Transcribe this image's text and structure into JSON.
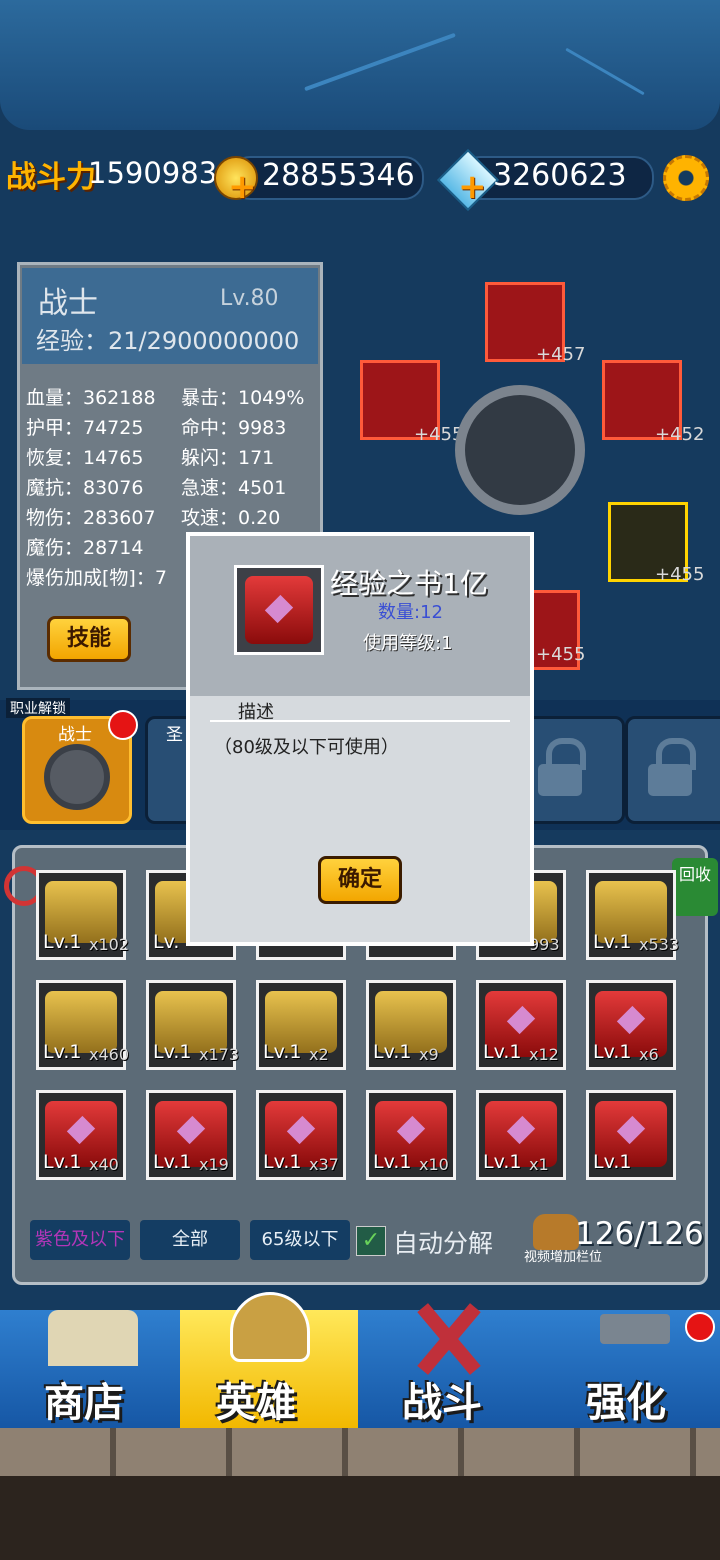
{
  "top_bar": {
    "power_label": "战斗力",
    "power_value": "15909830",
    "gold": "28855346",
    "diamonds": "3260623"
  },
  "hero_stats": {
    "class_name": "战士",
    "level": "Lv.80",
    "exp": "经验：21/2900000000",
    "stats": [
      "血量：362188",
      "暴击：1049%",
      "护甲：74725",
      "命中：9983",
      "恢复：14765",
      "躲闪：171",
      "魔抗：83076",
      "急速：4501",
      "物伤：283607",
      "攻速：0.20",
      "魔伤：28714",
      "爆伤加成[物]：7"
    ],
    "skill_button": "技能"
  },
  "equipment": {
    "bonuses": [
      "+457",
      "+455",
      "+452",
      "+455",
      "+455"
    ]
  },
  "class_row": {
    "label": "职业解锁",
    "tiles": [
      "战士",
      "圣"
    ]
  },
  "inventory": {
    "recycle_label": "回收",
    "rows": [
      [
        {
          "level": "Lv.1",
          "count": "x102",
          "type": "scroll"
        },
        {
          "level": "Lv.",
          "count": "",
          "type": "scroll"
        },
        {
          "level": "",
          "count": "",
          "type": "scroll"
        },
        {
          "level": "",
          "count": "",
          "type": "scroll"
        },
        {
          "level": "",
          "count": "993",
          "type": "scroll"
        },
        {
          "level": "Lv.1",
          "count": "x533",
          "type": "scroll"
        }
      ],
      [
        {
          "level": "Lv.1",
          "count": "x460",
          "type": "scroll"
        },
        {
          "level": "Lv.1",
          "count": "x173",
          "type": "scroll"
        },
        {
          "level": "Lv.1",
          "count": "x2",
          "type": "scroll"
        },
        {
          "level": "Lv.1",
          "count": "x9",
          "type": "scroll"
        },
        {
          "level": "Lv.1",
          "count": "x12",
          "type": "book"
        },
        {
          "level": "Lv.1",
          "count": "x6",
          "type": "book"
        }
      ],
      [
        {
          "level": "Lv.1",
          "count": "x40",
          "type": "book"
        },
        {
          "level": "Lv.1",
          "count": "x19",
          "type": "book"
        },
        {
          "level": "Lv.1",
          "count": "x37",
          "type": "book"
        },
        {
          "level": "Lv.1",
          "count": "x10",
          "type": "book"
        },
        {
          "level": "Lv.1",
          "count": "x1",
          "type": "book"
        },
        {
          "level": "Lv.1",
          "count": "",
          "type": "book"
        }
      ]
    ],
    "filters": [
      "紫色及以下",
      "全部",
      "65级以下"
    ],
    "auto_decompose_label": "自动分解",
    "auto_decompose_checked": true,
    "capacity": "126/126",
    "video_label": "视频增加栏位"
  },
  "nav": {
    "tabs": [
      "商店",
      "英雄",
      "战斗",
      "强化"
    ],
    "active": "英雄"
  },
  "modal": {
    "title": "经验之书1亿",
    "quantity": "数量:12",
    "use_level": "使用等级:1",
    "desc_label": "描述",
    "description": "（80级及以下可使用）",
    "ok_button": "确定"
  }
}
